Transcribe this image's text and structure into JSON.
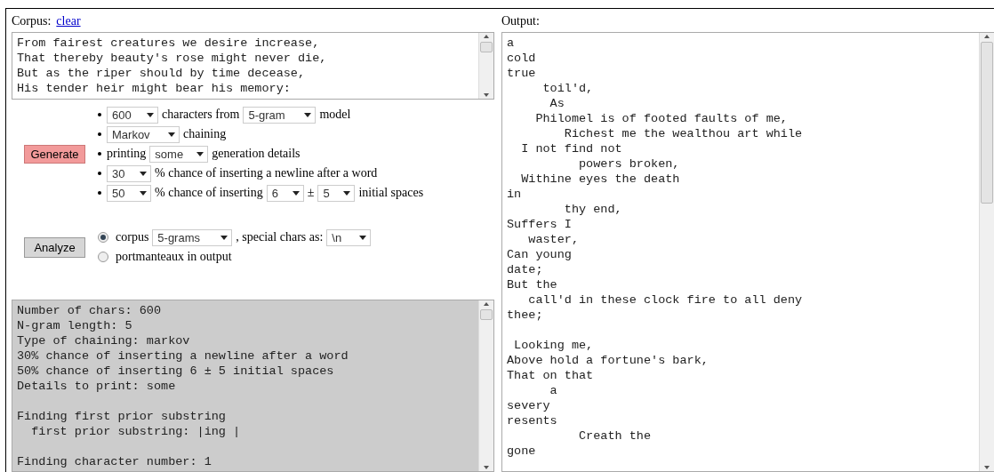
{
  "corpus": {
    "label": "Corpus:",
    "clear_link": "clear",
    "text": "From fairest creatures we desire increase,\nThat thereby beauty's rose might never die,\nBut as the riper should by time decease,\nHis tender heir might bear his memory:"
  },
  "generate": {
    "button": "Generate",
    "options": [
      {
        "parts": [
          {
            "kind": "select",
            "value": "600"
          },
          {
            "kind": "text",
            "text": "characters from"
          },
          {
            "kind": "select",
            "value": "5-gram"
          },
          {
            "kind": "text",
            "text": "model"
          }
        ]
      },
      {
        "parts": [
          {
            "kind": "select",
            "value": "Markov"
          },
          {
            "kind": "text",
            "text": "chaining"
          }
        ]
      },
      {
        "parts": [
          {
            "kind": "text",
            "text": "printing"
          },
          {
            "kind": "select",
            "value": "some"
          },
          {
            "kind": "text",
            "text": "generation details"
          }
        ]
      },
      {
        "parts": [
          {
            "kind": "select",
            "value": "30"
          },
          {
            "kind": "text",
            "text": "% chance of inserting a newline after a word"
          }
        ]
      },
      {
        "parts": [
          {
            "kind": "select",
            "value": "50"
          },
          {
            "kind": "text",
            "text": "% chance of inserting"
          },
          {
            "kind": "select",
            "value": "6"
          },
          {
            "kind": "text",
            "text": "±"
          },
          {
            "kind": "select",
            "value": "5"
          },
          {
            "kind": "text",
            "text": "initial spaces"
          }
        ]
      }
    ]
  },
  "analyze": {
    "button": "Analyze",
    "options": [
      {
        "selected": true,
        "parts": [
          {
            "kind": "text",
            "text": "corpus"
          },
          {
            "kind": "select",
            "value": "5-grams"
          },
          {
            "kind": "text",
            "text": ", special chars as:"
          },
          {
            "kind": "select",
            "value": "\\n"
          }
        ]
      },
      {
        "selected": false,
        "parts": [
          {
            "kind": "text",
            "text": "portmanteaux in output"
          }
        ]
      }
    ]
  },
  "log": {
    "text": "Number of chars: 600\nN-gram length: 5\nType of chaining: markov\n30% chance of inserting a newline after a word\n50% chance of inserting 6 ± 5 initial spaces\nDetails to print: some\n\nFinding first prior substring\n  first prior substring: |ing |\n\nFinding character number: 1"
  },
  "output": {
    "label": "Output:",
    "text": "a\ncold\ntrue\n     toil'd,\n      As\n    Philomel is of footed faults of me,\n        Richest me the wealthou art while\n  I not find not\n          powers broken,\n  Withine eyes the death\nin\n        thy end,\nSuffers I\n   waster,\nCan young\ndate;\nBut the\n   call'd in these clock fire to all deny\nthee;\n\n Looking me,\nAbove hold a fortune's bark,\nThat on that\n      a\nsevery\nresents\n          Creath the\ngone"
  }
}
